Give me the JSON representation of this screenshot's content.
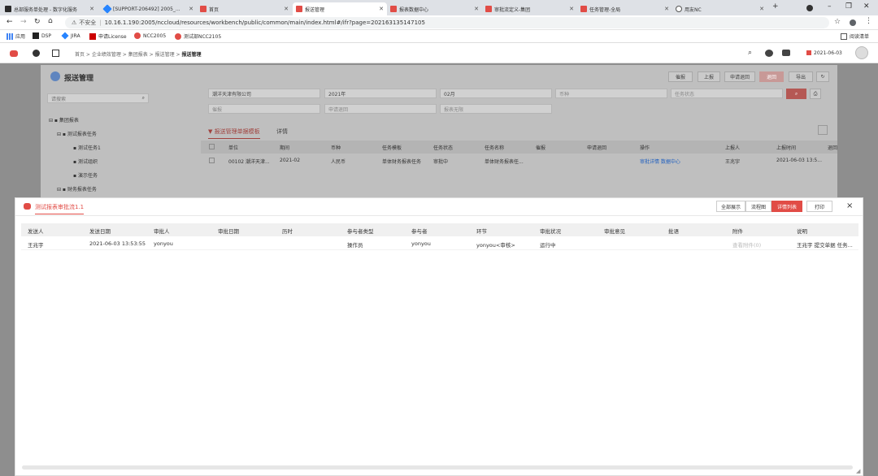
{
  "browser": {
    "tabs": [
      {
        "label": "总部服务单处理 - 数字化服务",
        "color": "#2b2b2b"
      },
      {
        "label": "[SUPPORT-206492] 2005_...",
        "color": "#2684ff"
      },
      {
        "label": "首页",
        "color": "#e14c46"
      },
      {
        "label": "报送管理",
        "color": "#e14c46"
      },
      {
        "label": "报表数据中心",
        "color": "#e14c46"
      },
      {
        "label": "审批流定义-集团",
        "color": "#e14c46"
      },
      {
        "label": "任务管理-全局",
        "color": "#e14c46"
      },
      {
        "label": "用友NC",
        "color": "#555555"
      }
    ],
    "new_tab": "+",
    "url_security": "不安全",
    "url": "10.16.1.190:2005/nccloud/resources/workbench/public/common/main/index.html#/ifr?page=202163135147105",
    "bookmarks": [
      "应用",
      "DSP",
      "JIRA",
      "申请License",
      "NCC2005",
      "测试部NCC2105"
    ],
    "reading_list": "阅读清单"
  },
  "app_header": {
    "breadcrumb": [
      "首页",
      "企业绩效管理",
      "集团报表",
      "报送管理",
      "报送管理"
    ],
    "date": "2021-06-03"
  },
  "page": {
    "title": "报送管理",
    "buttons": [
      "催报",
      "上报",
      "申请退回",
      "退回",
      "导出"
    ],
    "search_placeholder": "请搜索",
    "tree": [
      "集团报表",
      "测试报表任务",
      "测试任务1",
      "测试组织",
      "演示任务",
      "财务报表任务"
    ],
    "filters": {
      "org": "潮洋天津有限公司",
      "year": "2021年",
      "month": "02月",
      "currency_ph": "币种",
      "task_status_ph": "任务状态",
      "ph2": "催报",
      "apply_ph": "申请退回",
      "report_status_ph": "报表无限"
    },
    "tabs": [
      "报送管理单据模板",
      "详情"
    ],
    "columns": [
      "单位",
      "期间",
      "币种",
      "任务模板",
      "任务状态",
      "任务名称",
      "催报",
      "申请退回",
      "操作",
      "上报人",
      "上报时间",
      "退回"
    ],
    "row": [
      "00102 潮洋天津...",
      "2021-02",
      "人民币",
      "单体财务报表任务",
      "审批中",
      "单体财务报表任...",
      "",
      "",
      "审批详情  数据中心",
      "王兆宇",
      "2021-06-03 13:5..."
    ]
  },
  "modal": {
    "title": "测试报表审批流1.1",
    "buttons": [
      "全部展示",
      "流程图",
      "详情列表",
      "打印"
    ],
    "close": "×",
    "columns": [
      "发送人",
      "发送日期",
      "审批人",
      "审批日期",
      "历时",
      "参与者类型",
      "参与者",
      "环节",
      "审批状况",
      "审批意见",
      "批语",
      "附件",
      "说明"
    ],
    "rows": [
      [
        "王兆宇",
        "2021-06-03 13:53:55",
        "yonyou",
        "",
        "",
        "操作员",
        "yonyou",
        "yonyou<审核>",
        "运行中",
        "",
        "",
        "查看附件(0)",
        "王兆宇 提交单据 任务..."
      ]
    ]
  },
  "colors": {
    "accent": "#e14c46",
    "primary_blue": "#1f5fbf"
  }
}
